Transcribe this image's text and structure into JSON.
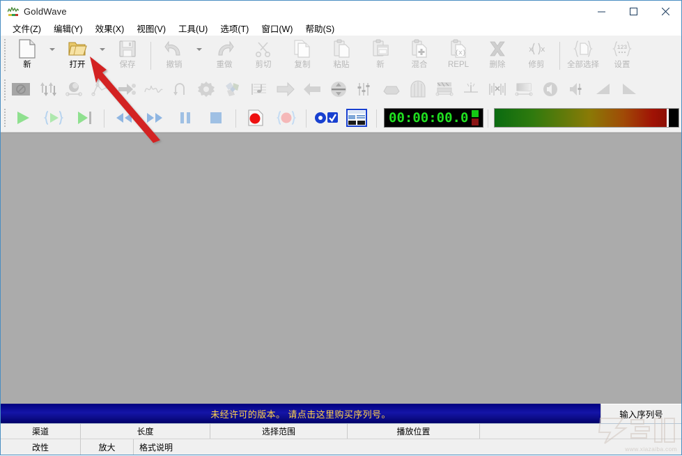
{
  "window": {
    "title": "GoldWave",
    "app_icon": "goldwave-waveform-icon",
    "controls": {
      "minimize": "minimize-icon",
      "maximize": "maximize-icon",
      "close": "close-icon"
    }
  },
  "menu": {
    "items": [
      {
        "label": "文件(Z)",
        "name": "menu-file"
      },
      {
        "label": "编辑(Y)",
        "name": "menu-edit"
      },
      {
        "label": "效果(X)",
        "name": "menu-effects"
      },
      {
        "label": "视图(V)",
        "name": "menu-view"
      },
      {
        "label": "工具(U)",
        "name": "menu-tools"
      },
      {
        "label": "选项(T)",
        "name": "menu-options"
      },
      {
        "label": "窗口(W)",
        "name": "menu-window"
      },
      {
        "label": "帮助(S)",
        "name": "menu-help"
      }
    ]
  },
  "toolbar_main": {
    "buttons": [
      {
        "label": "新",
        "icon": "new-file-icon",
        "enabled": true,
        "dropdown": true
      },
      {
        "label": "打开",
        "icon": "open-folder-icon",
        "enabled": true,
        "dropdown": true
      },
      {
        "label": "保存",
        "icon": "save-floppy-icon",
        "enabled": false,
        "dropdown": false
      },
      {
        "label": "撤销",
        "icon": "undo-arrow-icon",
        "enabled": false,
        "dropdown": true
      },
      {
        "label": "重做",
        "icon": "redo-arrow-icon",
        "enabled": false,
        "dropdown": false
      },
      {
        "label": "剪切",
        "icon": "scissors-icon",
        "enabled": false,
        "dropdown": false
      },
      {
        "label": "复制",
        "icon": "copy-pages-icon",
        "enabled": false,
        "dropdown": false
      },
      {
        "label": "粘贴",
        "icon": "paste-clipboard-icon",
        "enabled": false,
        "dropdown": false
      },
      {
        "label": "新",
        "icon": "paste-new-icon",
        "enabled": false,
        "dropdown": false
      },
      {
        "label": "混合",
        "icon": "mix-plus-icon",
        "enabled": false,
        "dropdown": false
      },
      {
        "label": "REPL",
        "icon": "replace-icon",
        "enabled": false,
        "dropdown": false
      },
      {
        "label": "删除",
        "icon": "delete-x-icon",
        "enabled": false,
        "dropdown": false
      },
      {
        "label": "修剪",
        "icon": "trim-icon",
        "enabled": false,
        "dropdown": false
      },
      {
        "label": "全部选择",
        "icon": "select-all-icon",
        "enabled": false,
        "dropdown": false
      },
      {
        "label": "设置",
        "icon": "settings-123-icon",
        "enabled": false,
        "dropdown": false
      }
    ]
  },
  "toolbar_effects": {
    "buttons": [
      {
        "icon": "no-effect-icon"
      },
      {
        "icon": "doppler-arrows-icon"
      },
      {
        "icon": "dynamics-icon"
      },
      {
        "icon": "filter-curve-icon"
      },
      {
        "icon": "echo-arrow-icon"
      },
      {
        "icon": "flanger-wave-icon"
      },
      {
        "icon": "reverse-loop-icon"
      },
      {
        "icon": "mechanize-gear-icon"
      },
      {
        "icon": "offset-shapes-icon"
      },
      {
        "icon": "pitch-note-icon"
      },
      {
        "icon": "resample-right-icon"
      },
      {
        "icon": "reverse-left-icon"
      },
      {
        "icon": "invert-updown-icon"
      },
      {
        "icon": "equalizer-sliders-icon"
      },
      {
        "icon": "compressor-icon"
      },
      {
        "icon": "reverb-hall-icon"
      },
      {
        "icon": "noise-reduction-icon"
      },
      {
        "icon": "pop-click-icon"
      },
      {
        "icon": "smoother-icon"
      },
      {
        "icon": "volume-shape-icon"
      },
      {
        "icon": "volume-speaker-icon"
      },
      {
        "icon": "volume-slider-icon"
      },
      {
        "icon": "fade-in-icon"
      },
      {
        "icon": "fade-out-icon"
      }
    ]
  },
  "transport": {
    "buttons": [
      {
        "icon": "play-icon",
        "name": "play-button"
      },
      {
        "icon": "play-selection-icon",
        "name": "play-selection-button"
      },
      {
        "icon": "play-to-end-icon",
        "name": "play-to-end-button"
      },
      {
        "icon": "rewind-icon",
        "name": "rewind-button"
      },
      {
        "icon": "fast-forward-icon",
        "name": "fast-forward-button"
      },
      {
        "icon": "pause-icon",
        "name": "pause-button"
      },
      {
        "icon": "stop-icon",
        "name": "stop-button"
      },
      {
        "icon": "record-icon",
        "name": "record-button"
      },
      {
        "icon": "record-selection-icon",
        "name": "record-selection-button"
      },
      {
        "icon": "record-options-icon",
        "name": "record-options-button"
      },
      {
        "icon": "window-layout-icon",
        "name": "window-layout-button"
      }
    ],
    "time_display": "00:00:00.0",
    "time_color": "#20e020",
    "led_green": "#14c814",
    "led_red": "#8b1414"
  },
  "banner": {
    "text": "未经许可的版本。 请点击这里购买序列号。",
    "text_color": "#ffd24a",
    "background_color": "#00007f",
    "serial_button": "输入序列号"
  },
  "status": {
    "row1": [
      "渠道",
      "长度",
      "选择范围",
      "播放位置",
      ""
    ],
    "row2": [
      "改性",
      "放大",
      "格式说明",
      "",
      ""
    ]
  },
  "annotation": {
    "arrow": "red-pointer-arrow",
    "arrow_color": "#d32020",
    "points_at": "打开"
  },
  "watermark": {
    "text": "www.xiazaiba.com",
    "logo": "xiazaiba-logo-icon"
  },
  "workspace": {
    "background_color": "#ababab"
  }
}
